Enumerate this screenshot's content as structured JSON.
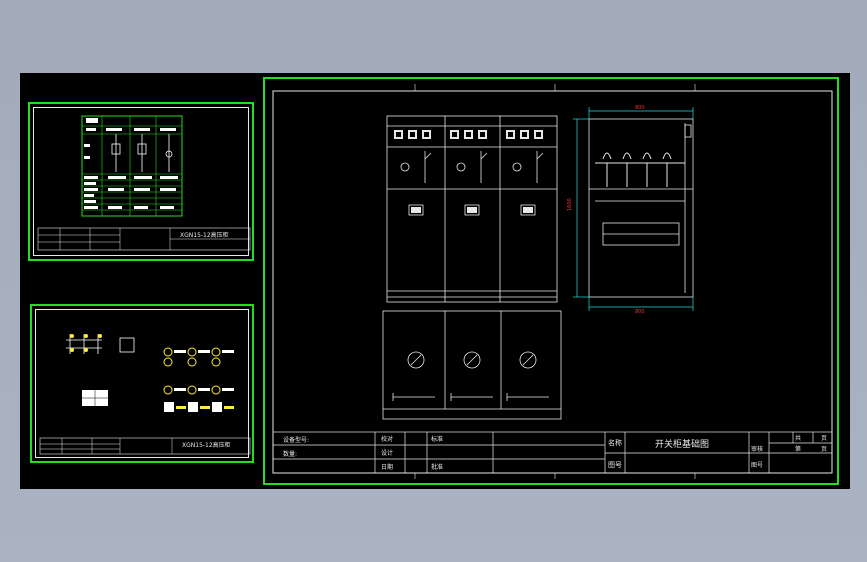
{
  "drawing": {
    "title": "开关柜基础图",
    "title_block": {
      "mingcheng_label": "名称",
      "tuhao_label": "图号",
      "sheet_label_a": "共",
      "sheet_label_b": "页",
      "sheet_label_c": "第",
      "sheet_label_d": "页",
      "jiaodui_label": "校对",
      "design_label": "设计",
      "shenhe_label": "审核",
      "riqi_label": "日期",
      "pizhun_label": "批准",
      "biaozhun_label": "标准",
      "left_label_a": "设备型号:",
      "left_label_b": "数量:"
    },
    "dimensions": {
      "width_top": "800",
      "height": "1600",
      "width_bottom": "800"
    }
  },
  "thumb1": {
    "title": "XGN15-12高压柜"
  },
  "thumb2": {
    "title": "XGN15-12高压柜"
  },
  "colors": {
    "viewport_bg": "#000000",
    "sheet_border": "#22dd22",
    "line": "#e8e8e8",
    "dimension": "#ff3030",
    "ext_line": "#22dddd",
    "symbol_yellow": "#ffee33"
  }
}
